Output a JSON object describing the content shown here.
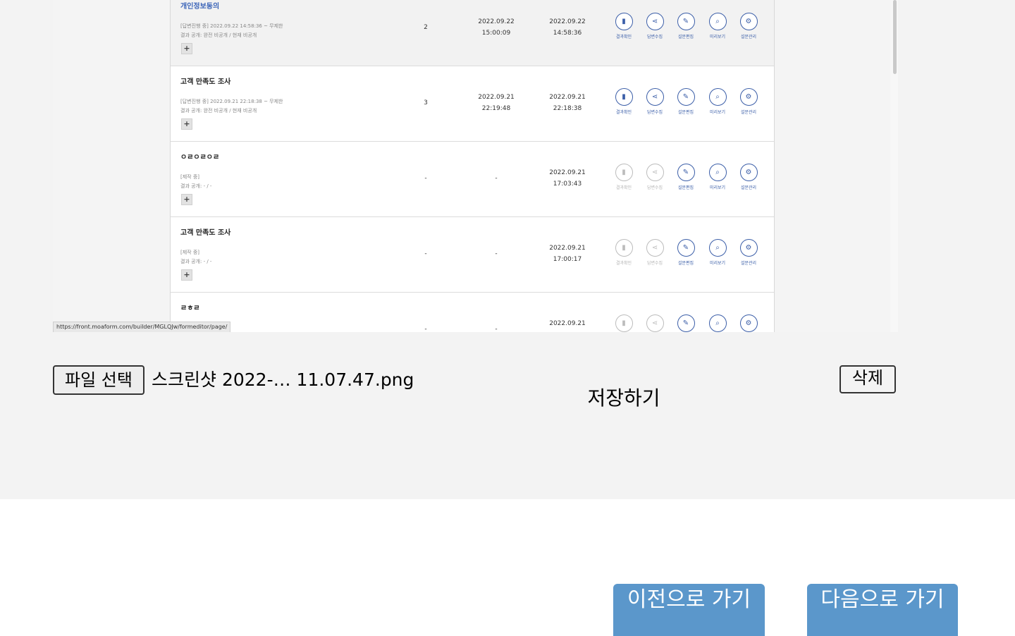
{
  "preview": {
    "status_url": "https://front.moaform.com/builder/MGLQJw/formeditor/page/",
    "rows": [
      {
        "title": "개인정보동의",
        "status_line": "[답변진행 중] 2022.09.22 14:58:36 ~ 무제한",
        "result_line": "결과 공개: 완전 비공개 / 현재 비공개",
        "plus": "+",
        "count": "2",
        "date1": "2022.09.22",
        "time1": "15:00:09",
        "date2": "2022.09.22",
        "time2": "14:58:36"
      },
      {
        "title": "고객 만족도 조사",
        "status_line": "[답변진행 중] 2022.09.21 22:18:38 ~ 무제한",
        "result_line": "결과 공개: 완전 비공개 / 현재 비공개",
        "plus": "+",
        "count": "3",
        "date1": "2022.09.21",
        "time1": "22:19:48",
        "date2": "2022.09.21",
        "time2": "22:18:38"
      },
      {
        "title": "ㅇㄹㅇㄹㅇㄹ",
        "status_line": "[제작 중]",
        "result_line": "결과 공개: - / -",
        "plus": "+",
        "count": "-",
        "date1": "-",
        "time1": "",
        "date2": "2022.09.21",
        "time2": "17:03:43"
      },
      {
        "title": "고객 만족도 조사",
        "status_line": "[제작 중]",
        "result_line": "결과 공개: - / -",
        "plus": "+",
        "count": "-",
        "date1": "-",
        "time1": "",
        "date2": "2022.09.21",
        "time2": "17:00:17"
      },
      {
        "title": "ㄹㅎㄹ",
        "status_line": "",
        "result_line": "",
        "plus": "",
        "count": "-",
        "date1": "-",
        "time1": "",
        "date2": "2022.09.21",
        "time2": ""
      }
    ],
    "actions": {
      "result": "결과확인",
      "collect": "답변수집",
      "edit": "설문편집",
      "preview": "미리보기",
      "manage": "설문관리"
    }
  },
  "upload": {
    "file_button": "파일 선택",
    "file_name": "스크린샷 2022-… 11.07.47.png",
    "save": "저장하기",
    "delete": "삭제"
  },
  "nav": {
    "prev": "이전으로 가기",
    "next": "다음으로 가기"
  },
  "colors": {
    "nav_button": "#5b97cb",
    "action_icon": "#3b5ea8",
    "disabled_icon": "#bcbcbc"
  }
}
